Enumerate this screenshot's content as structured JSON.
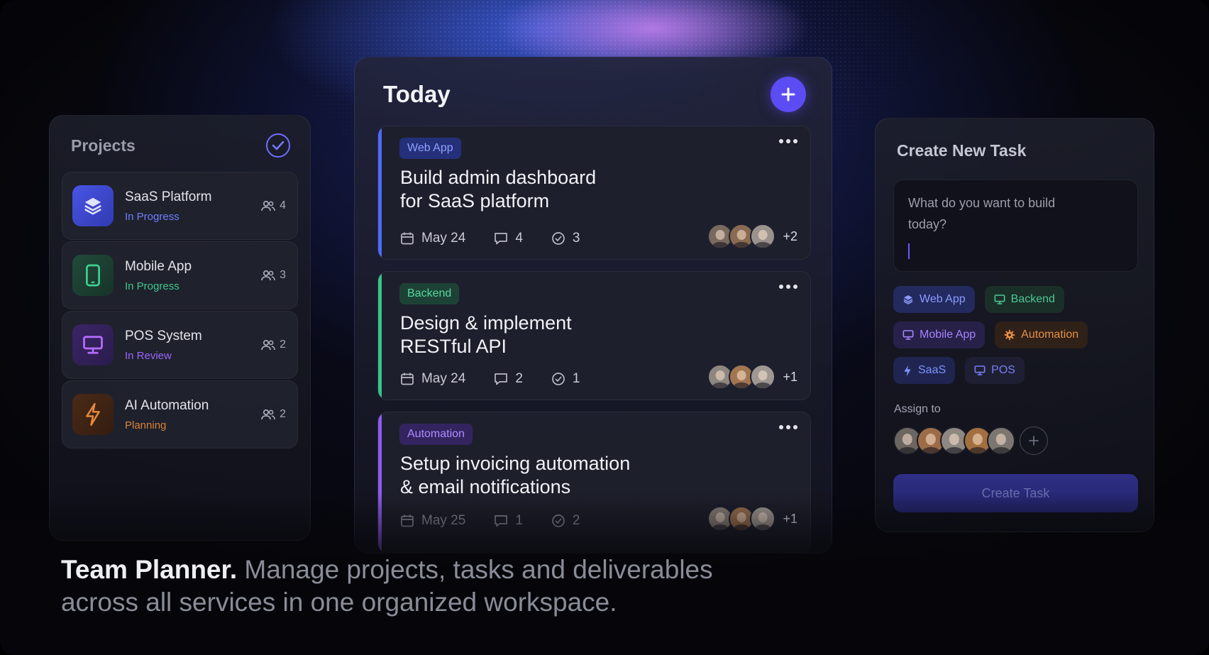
{
  "projects": {
    "title": "Projects",
    "items": [
      {
        "name": "SaaS Platform",
        "status": "In Progress",
        "members": "4",
        "icon": "layers-icon",
        "color": "#5b6cff"
      },
      {
        "name": "Mobile App",
        "status": "In Progress",
        "members": "3",
        "icon": "phone-icon",
        "color": "#3ec98a"
      },
      {
        "name": "POS System",
        "status": "In Review",
        "members": "2",
        "icon": "monitor-icon",
        "color": "#a05cff"
      },
      {
        "name": "AI Automation",
        "status": "Planning",
        "members": "2",
        "icon": "bolt-icon",
        "color": "#e08a3a"
      }
    ]
  },
  "today": {
    "title": "Today",
    "tasks": [
      {
        "tag": "Web App",
        "title_line1": "Build admin dashboard",
        "title_line2": "for SaaS platform",
        "date": "May 24",
        "comments": "4",
        "checks": "3",
        "more": "+2",
        "color": "#4f6bff"
      },
      {
        "tag": "Backend",
        "title_line1": "Design & implement",
        "title_line2": "RESTful API",
        "date": "May 24",
        "comments": "2",
        "checks": "1",
        "more": "+1",
        "color": "#36c58a"
      },
      {
        "tag": "Automation",
        "title_line1": "Setup invoicing automation",
        "title_line2": "& email notifications",
        "date": "May 25",
        "comments": "1",
        "checks": "2",
        "more": "+1",
        "color": "#8d5cf0"
      }
    ]
  },
  "create": {
    "title": "Create New Task",
    "placeholder": "What do you want to build today?",
    "chips": [
      "Web App",
      "Backend",
      "Mobile App",
      "Automation",
      "SaaS",
      "POS"
    ],
    "assign_label": "Assign to",
    "button": "Create Task"
  },
  "tagline": {
    "bold": "Team Planner.",
    "rest": " Manage projects, tasks and deliverables across all services in one organized workspace."
  }
}
